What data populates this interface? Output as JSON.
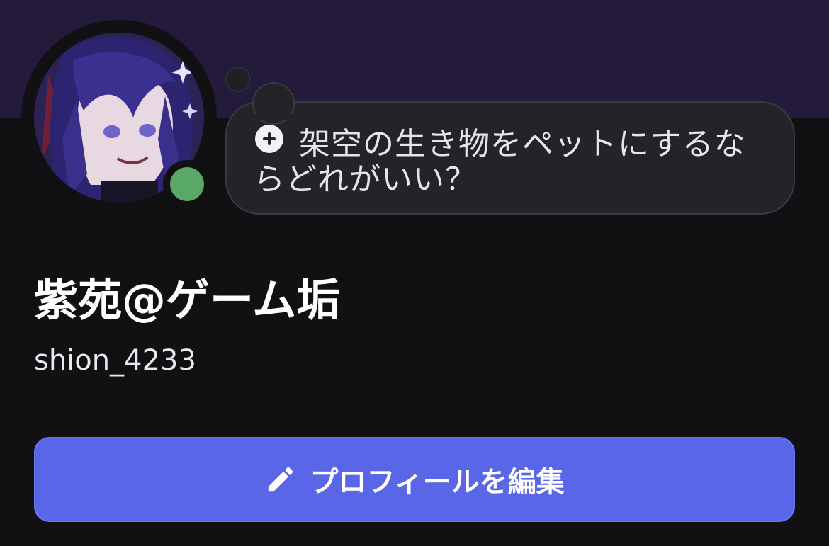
{
  "profile": {
    "display_name": "紫苑@ゲーム垢",
    "username": "shion_4233",
    "status": "online",
    "status_color": "#5aa867",
    "banner_color": "#241a3b"
  },
  "thought_bubble": {
    "icon": "plus-icon",
    "text": "架空の生き物をペットにするならどれがいい？"
  },
  "actions": {
    "edit_profile_icon": "pencil-icon",
    "edit_profile_label": "プロフィールを編集",
    "accent_color": "#5966e8"
  }
}
